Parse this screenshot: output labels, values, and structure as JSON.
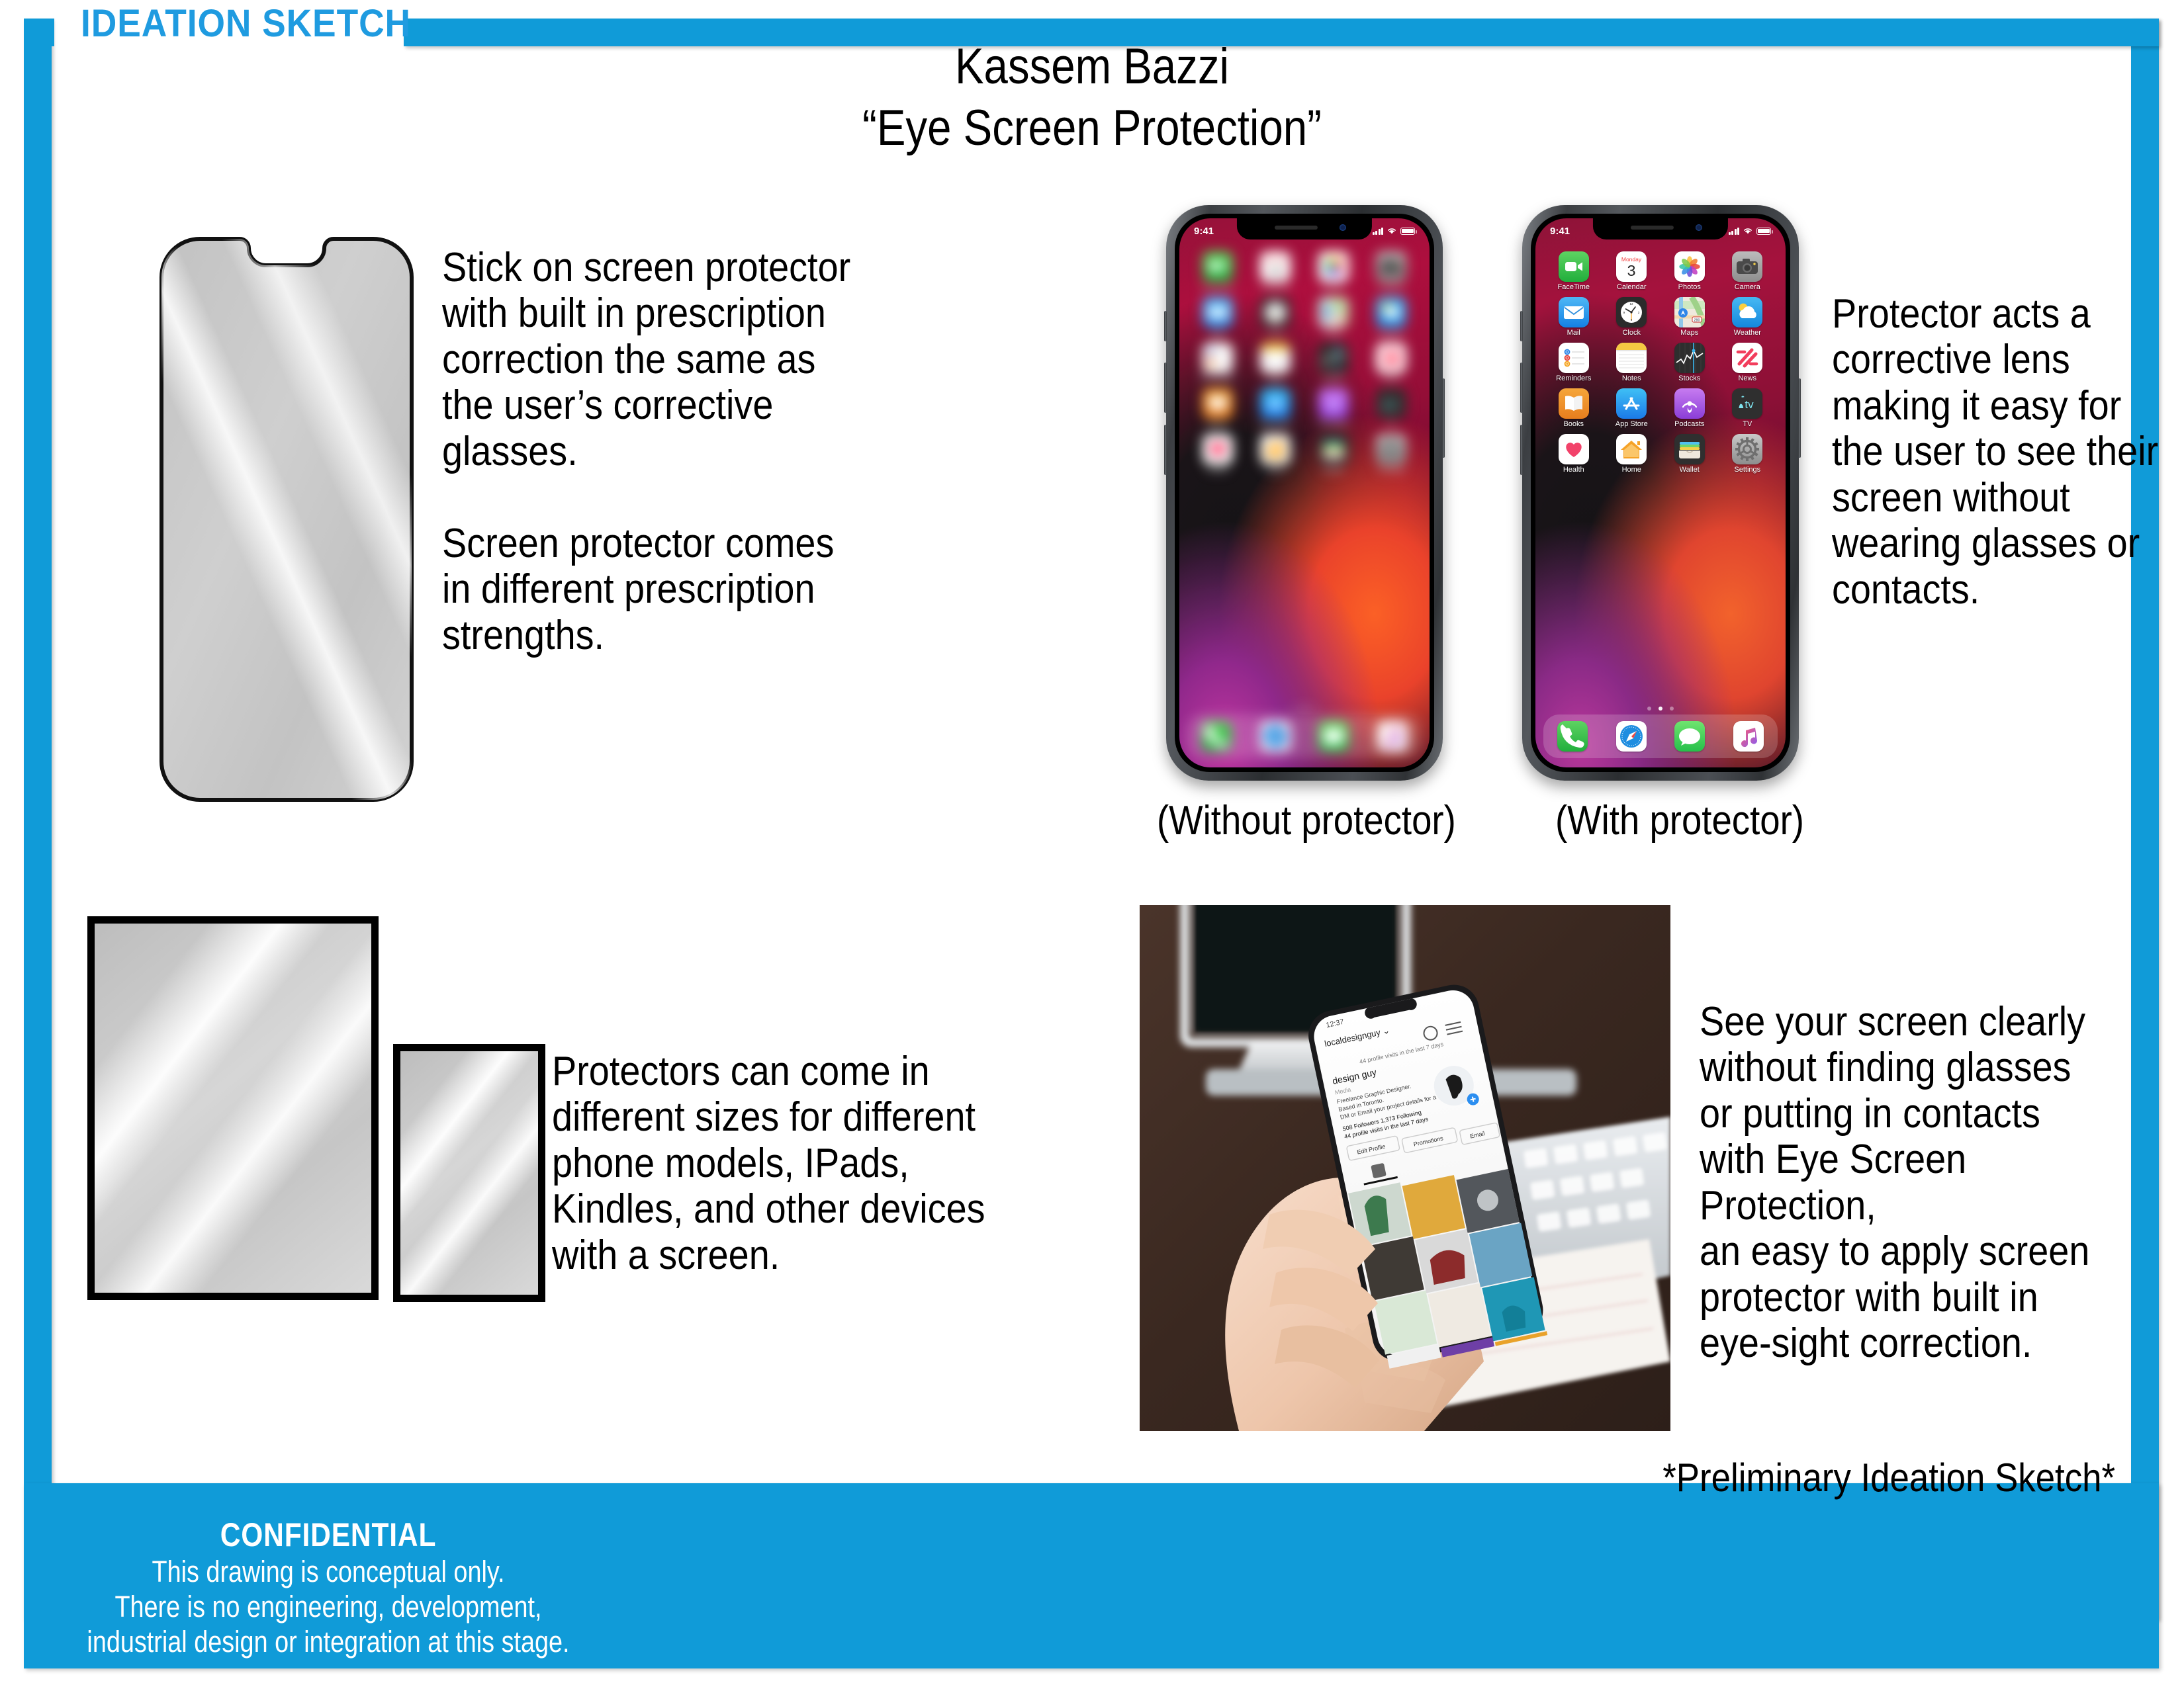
{
  "header": {
    "tag": "IDEATION SKETCH",
    "accent_color": "#109BD8"
  },
  "title": {
    "author": "Kassem Bazzi",
    "concept": "“Eye Screen Protection”"
  },
  "annotations": {
    "protector_desc": "Stick on screen protector\nwith built in prescription\ncorrection the same as\nthe user’s corrective glasses.\n\nScreen protector comes\nin different prescription\nstrengths.",
    "corrective_lens": "Protector acts a\ncorrective lens\nmaking it easy for\nthe user to see their\nscreen without\nwearing glasses or\ncontacts.",
    "sizes": "Protectors can come in\ndifferent sizes for different\nphone models, IPads,\nKindles, and other devices\nwith a screen.",
    "benefit": "See your screen clearly\nwithout finding glasses\nor putting in contacts\nwith Eye Screen Protection,\nan easy to apply screen\nprotector with built in\neye-sight correction."
  },
  "captions": {
    "without": "(Without protector)",
    "with": "(With protector)",
    "preliminary": "*Preliminary Ideation Sketch*"
  },
  "phone": {
    "status": {
      "time": "9:41",
      "signal_icon": "cellular-bars-icon",
      "wifi_icon": "wifi-icon",
      "battery_icon": "battery-icon"
    },
    "apps": [
      {
        "label": "FaceTime",
        "icon": "facetime-icon"
      },
      {
        "label": "Calendar",
        "icon": "calendar-icon",
        "weekday": "Monday",
        "day": "3"
      },
      {
        "label": "Photos",
        "icon": "photos-icon"
      },
      {
        "label": "Camera",
        "icon": "camera-icon"
      },
      {
        "label": "Mail",
        "icon": "mail-icon"
      },
      {
        "label": "Clock",
        "icon": "clock-icon"
      },
      {
        "label": "Maps",
        "icon": "maps-icon",
        "route": "280"
      },
      {
        "label": "Weather",
        "icon": "weather-icon"
      },
      {
        "label": "Reminders",
        "icon": "reminders-icon"
      },
      {
        "label": "Notes",
        "icon": "notes-icon"
      },
      {
        "label": "Stocks",
        "icon": "stocks-icon"
      },
      {
        "label": "News",
        "icon": "news-icon"
      },
      {
        "label": "Books",
        "icon": "books-icon"
      },
      {
        "label": "App Store",
        "icon": "app-store-icon"
      },
      {
        "label": "Podcasts",
        "icon": "podcasts-icon"
      },
      {
        "label": "TV",
        "icon": "tv-icon"
      },
      {
        "label": "Health",
        "icon": "health-icon"
      },
      {
        "label": "Home",
        "icon": "home-icon"
      },
      {
        "label": "Wallet",
        "icon": "wallet-icon"
      },
      {
        "label": "Settings",
        "icon": "settings-icon"
      }
    ],
    "dock": [
      {
        "label": "Phone",
        "icon": "phone-icon"
      },
      {
        "label": "Safari",
        "icon": "safari-icon"
      },
      {
        "label": "Messages",
        "icon": "messages-icon"
      },
      {
        "label": "Music",
        "icon": "music-icon"
      }
    ],
    "page_dots": 3,
    "active_dot": 2
  },
  "footer": {
    "title": "CONFIDENTIAL",
    "line1": "This drawing is conceptual only.",
    "line2": "There is no engineering, development,",
    "line3": "industrial design or integration at this stage."
  }
}
